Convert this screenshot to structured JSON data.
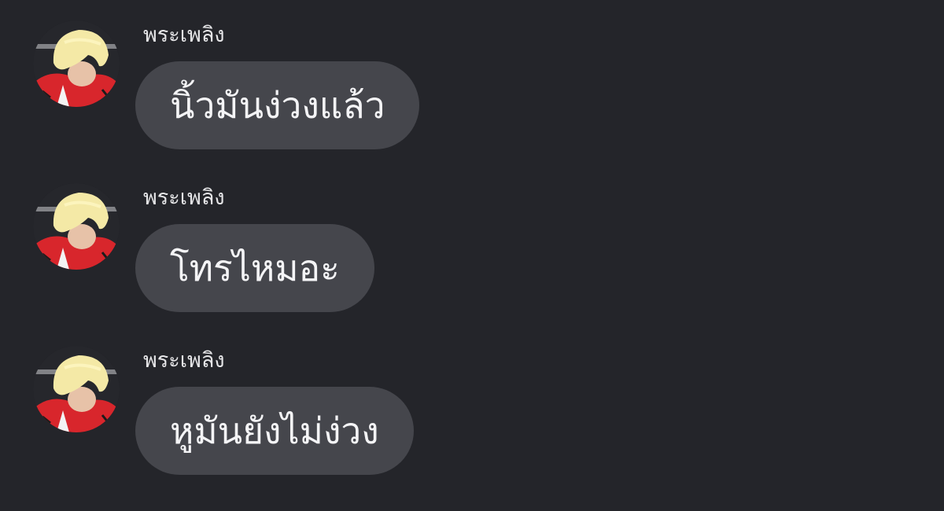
{
  "theme": {
    "background": "#24252a",
    "bubble": "#45464c",
    "text": "#f4f4f6",
    "sender_text": "#e6e6e8"
  },
  "messages": [
    {
      "sender": "พระเพลิง",
      "avatar": "avatar-photo",
      "text": "นิ้วมันง่วงแล้ว"
    },
    {
      "sender": "พระเพลิง",
      "avatar": "avatar-photo",
      "text": "โทรไหมอะ"
    },
    {
      "sender": "พระเพลิง",
      "avatar": "avatar-photo",
      "text": "หูมันยังไม่ง่วง"
    }
  ]
}
